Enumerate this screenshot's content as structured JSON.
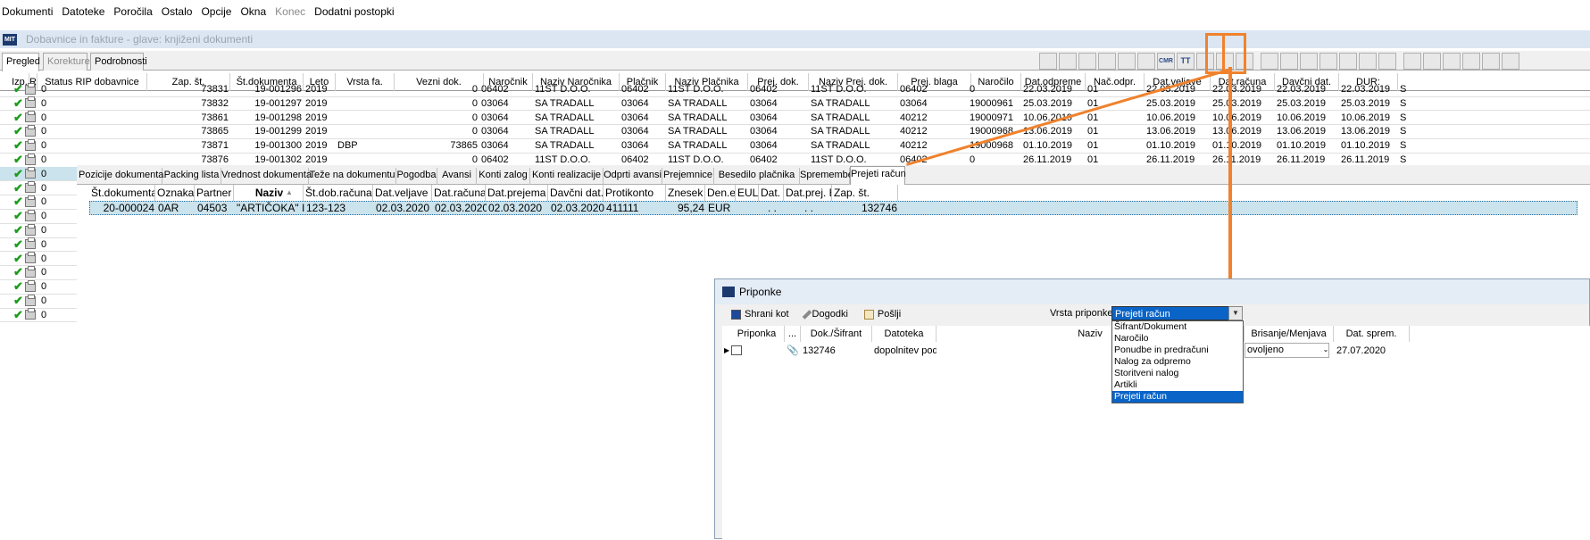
{
  "menu": [
    "Dokumenti",
    "Datoteke",
    "Poročila",
    "Ostalo",
    "Opcije",
    "Okna",
    "Konec",
    "Dodatni postopki"
  ],
  "window": {
    "logo": "MIT",
    "title": "Dobavnice in fakture - glave: knjiženi dokumenti"
  },
  "main_tabs": [
    "Pregled",
    "Korekture",
    "Podrobnosti"
  ],
  "toolbar_icons": [
    "document-icon",
    "refresh-icon",
    "tools-icon",
    "copy-icon",
    "open-icon",
    "notes-icon",
    "cmr-label",
    "text-tt-icon",
    "pdf-icon",
    "print-preview-icon",
    "internet-icon",
    "square-icon",
    "exit-icon",
    "export-icon",
    "filter-dropdown-icon",
    "attachment-icon",
    "form-icon",
    "help-icon",
    "blank-icon",
    "folder-icon",
    "printer-icon",
    "search-icon",
    "funnel-icon",
    "close-icon"
  ],
  "toolbar_text": {
    "cmr": "CMR",
    "tt": "TT"
  },
  "grid": {
    "columns": [
      "Izp.",
      "R",
      "Status RIP dobavnice",
      "Zap. št.",
      "Št.dokumenta",
      "Leto",
      "Vrsta fa.",
      "Vezni dok.",
      "Naročnik",
      "Naziv Naročnika",
      "Plačnik",
      "Naziv Plačnika",
      "Prej. dok.",
      "Naziv Prej. dok.",
      "Prej. blaga",
      "Naročilo",
      "Dat.odpreme",
      "Nač.odpr.",
      "Dat.veljave",
      "Dat.računa",
      "Davčni dat.",
      "DUR:"
    ],
    "rows": [
      {
        "status": "0",
        "zap": "73831",
        "dok": "19-001296",
        "leto": "2019",
        "vrsta": "",
        "vezni": "0",
        "narocnik": "06402",
        "naziv_n": "11ST D.O.O.",
        "placnik": "06402",
        "naziv_p": "11ST D.O.O.",
        "prej": "06402",
        "naziv_prej": "11ST D.O.O.",
        "blaga": "06402",
        "narocilo": "0",
        "odpreme": "22.03.2019",
        "nac": "01",
        "veljave": "22.03.2019",
        "racuna": "22.03.2019",
        "davcni": "22.03.2019",
        "dur": "22.03.2019"
      },
      {
        "status": "0",
        "zap": "73832",
        "dok": "19-001297",
        "leto": "2019",
        "vrsta": "",
        "vezni": "0",
        "narocnik": "03064",
        "naziv_n": "SA TRADALL",
        "placnik": "03064",
        "naziv_p": "SA TRADALL",
        "prej": "03064",
        "naziv_prej": "SA TRADALL",
        "blaga": "03064",
        "narocilo": "19000961",
        "odpreme": "25.03.2019",
        "nac": "01",
        "veljave": "25.03.2019",
        "racuna": "25.03.2019",
        "davcni": "25.03.2019",
        "dur": "25.03.2019"
      },
      {
        "status": "0",
        "zap": "73861",
        "dok": "19-001298",
        "leto": "2019",
        "vrsta": "",
        "vezni": "0",
        "narocnik": "03064",
        "naziv_n": "SA TRADALL",
        "placnik": "03064",
        "naziv_p": "SA TRADALL",
        "prej": "03064",
        "naziv_prej": "SA TRADALL",
        "blaga": "40212",
        "narocilo": "19000971",
        "odpreme": "10.06.2019",
        "nac": "01",
        "veljave": "10.06.2019",
        "racuna": "10.06.2019",
        "davcni": "10.06.2019",
        "dur": "10.06.2019"
      },
      {
        "status": "0",
        "zap": "73865",
        "dok": "19-001299",
        "leto": "2019",
        "vrsta": "",
        "vezni": "0",
        "narocnik": "03064",
        "naziv_n": "SA TRADALL",
        "placnik": "03064",
        "naziv_p": "SA TRADALL",
        "prej": "03064",
        "naziv_prej": "SA TRADALL",
        "blaga": "40212",
        "narocilo": "19000968",
        "odpreme": "13.06.2019",
        "nac": "01",
        "veljave": "13.06.2019",
        "racuna": "13.06.2019",
        "davcni": "13.06.2019",
        "dur": "13.06.2019"
      },
      {
        "status": "0",
        "zap": "73871",
        "dok": "19-001300",
        "leto": "2019",
        "vrsta": "DBP",
        "vezni": "73865",
        "narocnik": "03064",
        "naziv_n": "SA TRADALL",
        "placnik": "03064",
        "naziv_p": "SA TRADALL",
        "prej": "03064",
        "naziv_prej": "SA TRADALL",
        "blaga": "40212",
        "narocilo": "19000968",
        "odpreme": "01.10.2019",
        "nac": "01",
        "veljave": "01.10.2019",
        "racuna": "01.10.2019",
        "davcni": "01.10.2019",
        "dur": "01.10.2019"
      },
      {
        "status": "0",
        "zap": "73876",
        "dok": "19-001302",
        "leto": "2019",
        "vrsta": "",
        "vezni": "0",
        "narocnik": "06402",
        "naziv_n": "11ST D.O.O.",
        "placnik": "06402",
        "naziv_p": "11ST D.O.O.",
        "prej": "06402",
        "naziv_prej": "11ST D.O.O.",
        "blaga": "06402",
        "narocilo": "0",
        "odpreme": "26.11.2019",
        "nac": "01",
        "veljave": "26.11.2019",
        "racuna": "26.11.2019",
        "davcni": "26.11.2019",
        "dur": "26.11.2019"
      }
    ],
    "extra_status_rows": [
      "0",
      "0",
      "0",
      "0",
      "0",
      "0",
      "0",
      "0",
      "0",
      "0",
      "0"
    ],
    "extra_status_tail": "S"
  },
  "detail_tabs": [
    "Pozicije dokumenta",
    "Packing lista",
    "Vrednost dokumenta",
    "Teže na dokumentu",
    "Pogodba",
    "Avansi",
    "Konti zalog",
    "Konti realizacije",
    "Odprti avansi",
    "Prejemnice",
    "Besedilo plačnika",
    "Spremembe",
    "Prejeti račun"
  ],
  "detail_grid": {
    "columns": [
      "Št.dokumenta",
      "Oznaka",
      "Partner",
      "Naziv",
      "Št.dob.računa",
      "Dat.veljave",
      "Dat.računa",
      "Dat.prejema",
      "Davčni dat.",
      "Protikonto",
      "Znesek",
      "Den.enota",
      "EUL",
      "Dat. EUL",
      "Dat.prej. EUL",
      "Zap. št."
    ],
    "sort_indicator": "▲",
    "row": {
      "dok": "20-000024",
      "oznaka": "0AR",
      "partner": "04503",
      "naziv": "\"ARTIČOKA\" I",
      "stdob": "123-123",
      "veljave": "02.03.2020",
      "racuna": "02.03.2020",
      "prejema": "02.03.2020",
      "davcni": "02.03.2020",
      "protikonto": "411111",
      "znesek": "95,24",
      "den": "EUR",
      "eul": "",
      "dateul": ". .",
      "datprej": ". .",
      "zap": "132746"
    }
  },
  "dialog": {
    "title": "Priponke",
    "toolbar": {
      "save": "Shrani kot",
      "events": "Dogodki",
      "send": "Pošlji"
    },
    "vrsta_label": "Vrsta priponke:",
    "vrsta_selected": "Prejeti račun",
    "vrsta_options": [
      "Šifrant/Dokument",
      "Naročilo",
      "Ponudbe in predračuni",
      "Nalog za odpremo",
      "Storitveni nalog",
      "Artikli",
      "Prejeti račun"
    ],
    "columns": [
      "Priponka",
      "...",
      "Dok./Šifrant",
      "Datoteka",
      "Naziv",
      "Brisanje/Menjava",
      "Dat. sprem."
    ],
    "row": {
      "dok": "132746",
      "datoteka": "dopolnitev podpi:",
      "brisanje": "ovoljeno",
      "dat": "27.07.2020"
    }
  },
  "colors": {
    "accent": "#f0822d",
    "selection": "#0a64c8",
    "check": "#1c9c1c"
  }
}
